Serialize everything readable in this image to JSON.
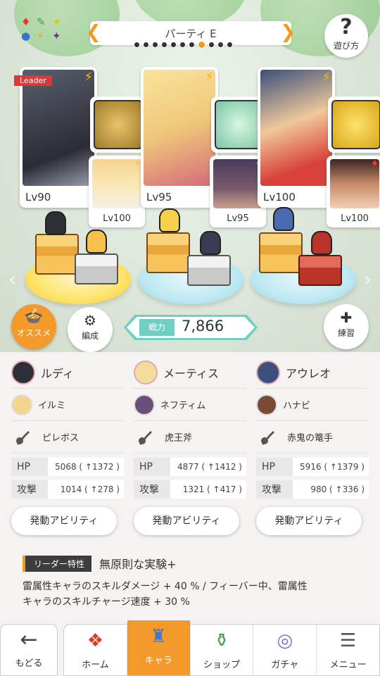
{
  "party": {
    "title": "パーティ E",
    "dot_count": 11,
    "active_dot": 7
  },
  "help": {
    "label": "遊び方"
  },
  "teams": [
    {
      "leader_tag": "Leader",
      "main_level": "Lv90",
      "sub_level": "Lv100",
      "portrait_color": "#3b3e4a",
      "equip_color": "#c2a24a",
      "sub_color": "#f4d58f",
      "sub_tag": "✧"
    },
    {
      "leader_tag": "",
      "main_level": "Lv95",
      "sub_level": "Lv95",
      "portrait_color": "#f2d680",
      "equip_color": "#7fb8d8",
      "sub_color": "#6a4f7b",
      "sub_tag": "✧"
    },
    {
      "leader_tag": "",
      "main_level": "Lv100",
      "sub_level": "Lv100",
      "portrait_color": "#7a9ccf",
      "equip_color": "#d94834",
      "sub_color": "#7a4a33",
      "sub_tag": "♦"
    }
  ],
  "buttons": {
    "osusume": "オススメ",
    "hensei": "編成",
    "renshu": "練習"
  },
  "power": {
    "label": "戦力",
    "value": "7,866"
  },
  "columns": [
    {
      "main_name": "ルディ",
      "sub_name": "イルミ",
      "weapon": "ピレボス",
      "hp_label": "HP",
      "hp": "5068 ( ↑1372 )",
      "atk_label": "攻撃",
      "atk": "1014 ( ↑278 )",
      "ability": "発動アビリティ"
    },
    {
      "main_name": "メーティス",
      "sub_name": "ネフティム",
      "weapon": "虎王斧",
      "hp_label": "HP",
      "hp": "4877 ( ↑1412 )",
      "atk_label": "攻撃",
      "atk": "1321 ( ↑417 )",
      "ability": "発動アビリティ"
    },
    {
      "main_name": "アウレオ",
      "sub_name": "ハナビ",
      "weapon": "赤鬼の篭手",
      "hp_label": "HP",
      "hp": "5916 ( ↑1379 )",
      "atk_label": "攻撃",
      "atk": "980 ( ↑336 )",
      "ability": "発動アビリティ"
    }
  ],
  "leader_trait": {
    "label": "リーダー特性",
    "name": "無原則な実験+",
    "desc_line1": "雷属性キャラのスキルダメージ + 40 % / フィーバー中、雷属性",
    "desc_line2": "キャラのスキルチャージ速度 + 30 %"
  },
  "nav": {
    "back": "もどる",
    "tabs": [
      {
        "label": "ホーム",
        "icon": "home-icon"
      },
      {
        "label": "キャラ",
        "icon": "chara-icon"
      },
      {
        "label": "ショップ",
        "icon": "shop-icon"
      },
      {
        "label": "ガチャ",
        "icon": "gacha-icon"
      },
      {
        "label": "メニュー",
        "icon": "menu-icon"
      }
    ],
    "active_tab": 1
  }
}
